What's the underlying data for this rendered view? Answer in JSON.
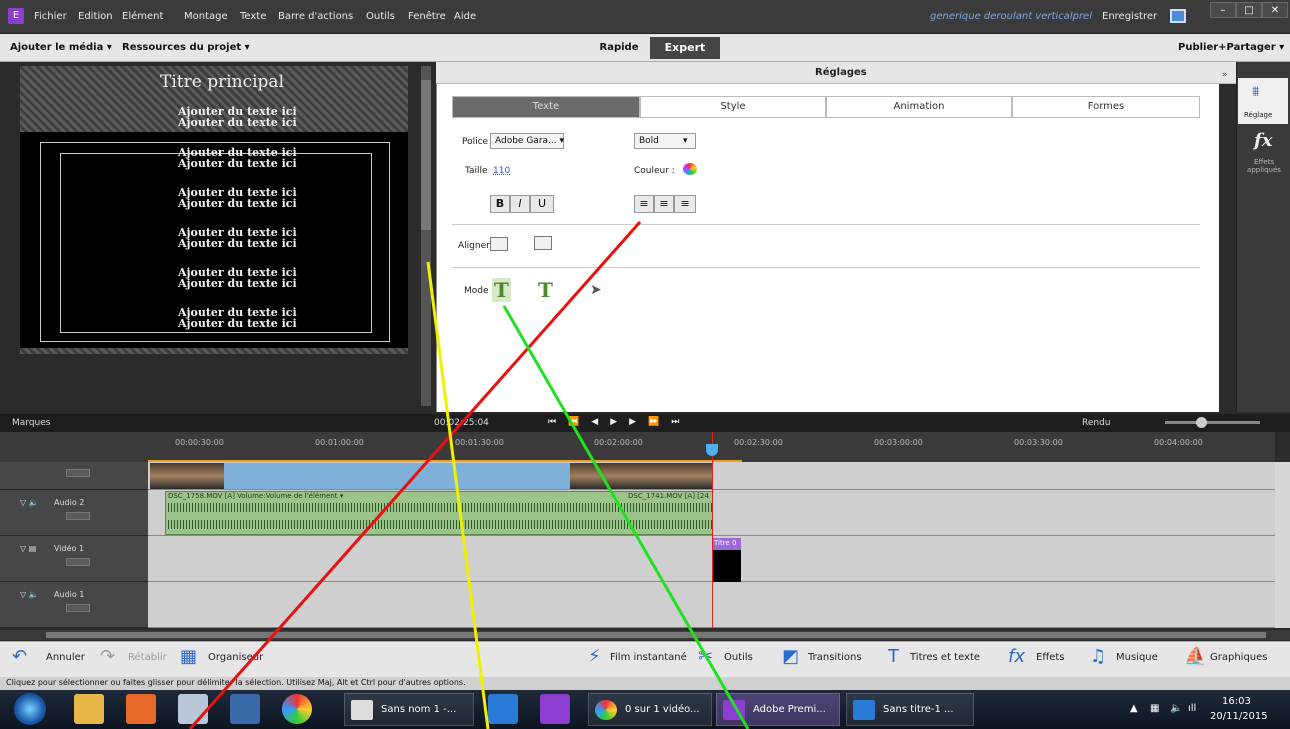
{
  "menubar": {
    "items": [
      "Fichier",
      "Edition",
      "Elément",
      "Montage",
      "Texte",
      "Barre d'actions",
      "Outils",
      "Fenêtre",
      "Aide"
    ],
    "doc_title": "generique deroulant verticalprel",
    "save_label": "Enregistrer"
  },
  "toolbar": {
    "add_media": "Ajouter le média ▾",
    "project_resources": "Ressources du projet ▾",
    "rapide": "Rapide",
    "expert": "Expert",
    "publish": "Publier+Partager ▾"
  },
  "preview": {
    "title_main": "Titre principal",
    "text_lines": [
      "Ajouter du texte ici",
      "Ajouter du texte ici",
      "Ajouter du texte ici",
      "Ajouter du texte ici",
      "Ajouter du texte ici",
      "Ajouter du texte ici",
      "Ajouter du texte ici",
      "Ajouter du texte ici",
      "Ajouter du texte ici",
      "Ajouter du texte ici",
      "Ajouter du texte ici",
      "Ajouter du texte ici"
    ]
  },
  "settings": {
    "header": "Réglages",
    "collapse": "»",
    "tabs": [
      "Texte",
      "Style",
      "Animation",
      "Formes"
    ],
    "font_label": "Police",
    "font_value": "Adobe Gara... ▾",
    "weight_value": "Bold",
    "size_label": "Taille",
    "size_value": "110",
    "color_label": "Couleur :",
    "bold": "B",
    "italic": "I",
    "underline": "U",
    "align_label": "Aligner",
    "mode_label": "Mode"
  },
  "rightpanel": {
    "reglage_label": "Réglage",
    "fx_label": "Effets appliqués"
  },
  "timeline": {
    "marques": "Marques",
    "timecode": "00:02:25:04",
    "rendu": "Rendu",
    "ruler": [
      "00:00:30:00",
      "00:01:00:00",
      "00:01:30:00",
      "00:02:00:00",
      "00:02:30:00",
      "00:03:00:00",
      "00:03:30:00",
      "00:04:00:00"
    ],
    "tracks": [
      "Audio 2",
      "Vidéo 1",
      "Audio 1"
    ],
    "clip_a1": "DSC_1758.MOV [A]  Volume:Volume de l'élément ▾",
    "clip_a2": "DSC_1741.MOV [A] [24",
    "titre": "Titre 0"
  },
  "actions": {
    "annuler": "Annuler",
    "retablir": "Rétablir",
    "organiseur": "Organiseur",
    "film": "Film instantané",
    "outils": "Outils",
    "transitions": "Transitions",
    "titres": "Titres et texte",
    "effets": "Effets",
    "musique": "Musique",
    "graphiques": "Graphiques"
  },
  "status_text": "Cliquez pour sélectionner ou faites glisser pour délimiter la sélection. Utilisez Maj, Alt et Ctrl pour d'autres options.",
  "taskbar": {
    "windows": [
      "Sans nom 1 -...",
      "0 sur 1 vidéo...",
      "Adobe Premi...",
      "Sans titre-1 ..."
    ],
    "time": "16:03",
    "date": "20/11/2015"
  },
  "colors": {
    "annotation_red": "#e81010",
    "annotation_yellow": "#f0f000",
    "annotation_green": "#20e020"
  }
}
